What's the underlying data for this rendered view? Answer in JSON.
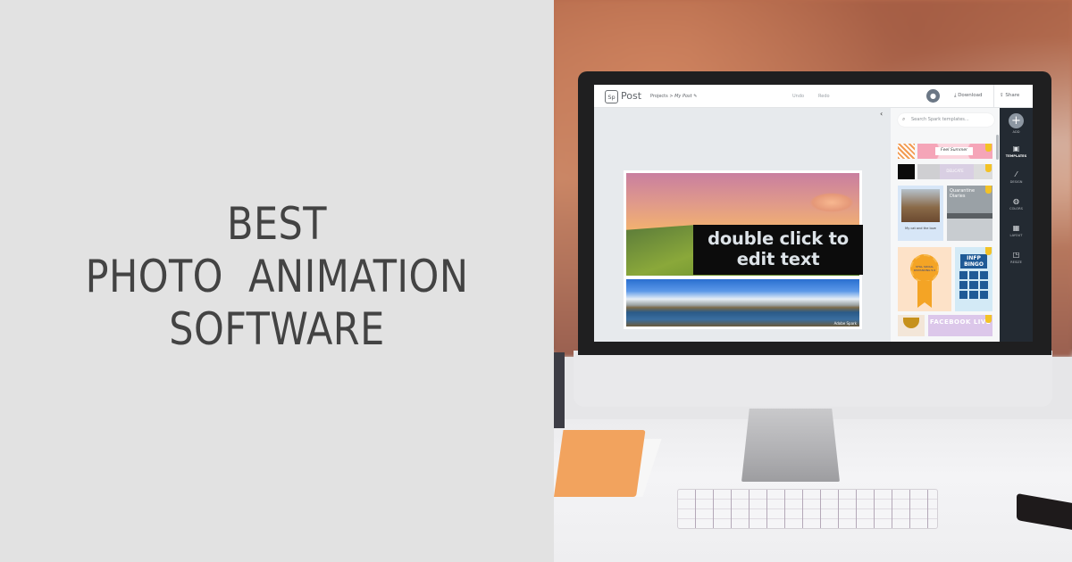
{
  "headline": {
    "line1": "BEST",
    "line2": "PHOTO  ANIMATION",
    "line3": "SOFTWARE"
  },
  "app": {
    "logo_mark": "Sp",
    "logo_name": "Post",
    "breadcrumb": {
      "root": "Projects",
      "separator": ">",
      "current": "My Post",
      "edit_icon": "pencil-icon"
    },
    "undo_label": "Undo",
    "redo_label": "Redo",
    "avatar_icon": "user-icon",
    "download_label": "Download",
    "download_icon": "download-icon",
    "share_label": "Share",
    "share_icon": "share-icon",
    "collapse_icon": "chevron-left-icon",
    "canvas": {
      "text_box": "double click to edit text",
      "photo_credit": "Adobe Spark"
    },
    "search": {
      "placeholder": "Search Spark templates...",
      "icon": "search-icon"
    },
    "templates": [
      {
        "title": "pattern"
      },
      {
        "title": "Feel Summer"
      },
      {
        "title": "dark pattern"
      },
      {
        "title": "DELICATE"
      },
      {
        "title": "My cat and the love"
      },
      {
        "title": "Quarantine Diaries"
      },
      {
        "title": "STILL SOCIAL DISTANCING 5.0"
      },
      {
        "title": "INFP BINGO"
      },
      {
        "title": "trophy"
      },
      {
        "title": "FACEBOOK LIVE"
      }
    ],
    "rail": [
      {
        "label": "ADD",
        "icon": "plus-icon"
      },
      {
        "label": "TEMPLATES",
        "icon": "templates-icon",
        "active": true
      },
      {
        "label": "DESIGN",
        "icon": "magic-wand-icon"
      },
      {
        "label": "COLORS",
        "icon": "palette-icon"
      },
      {
        "label": "LAYOUT",
        "icon": "layout-icon"
      },
      {
        "label": "RESIZE",
        "icon": "resize-icon"
      }
    ]
  }
}
